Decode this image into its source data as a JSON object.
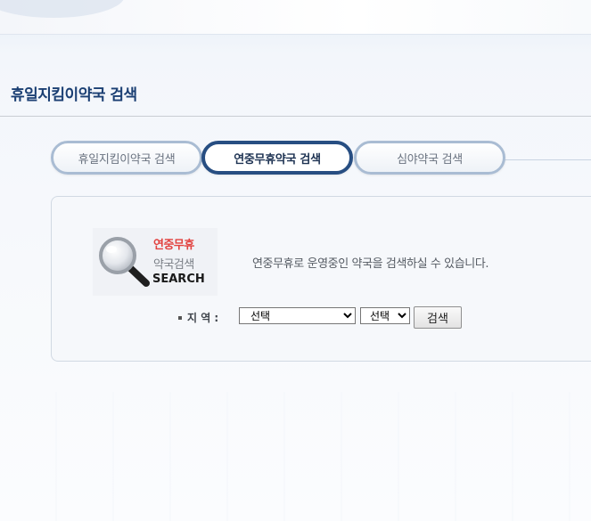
{
  "header": {
    "page_title": "휴일지킴이약국 검색"
  },
  "tabs": [
    {
      "label": "휴일지킴이약국 검색",
      "active": false
    },
    {
      "label": "연중무휴약국 검색",
      "active": true
    },
    {
      "label": "심야약국 검색",
      "active": false
    }
  ],
  "search_panel": {
    "logo": {
      "line1": "연중무휴",
      "line2": "약국검색",
      "line3": "SEARCH",
      "icon": "magnifier-icon"
    },
    "description": "연중무휴로 운영중인 약국을 검색하실 수 있습니다.",
    "region_label": "지 역 :",
    "region_select_value": "선택",
    "subregion_select_value": "선택",
    "search_button_label": "검색"
  },
  "colors": {
    "title": "#1b3f73",
    "active_tab_border": "#274e82",
    "inactive_tab_border": "#a9bcd3",
    "logo_accent": "#e2423f"
  }
}
